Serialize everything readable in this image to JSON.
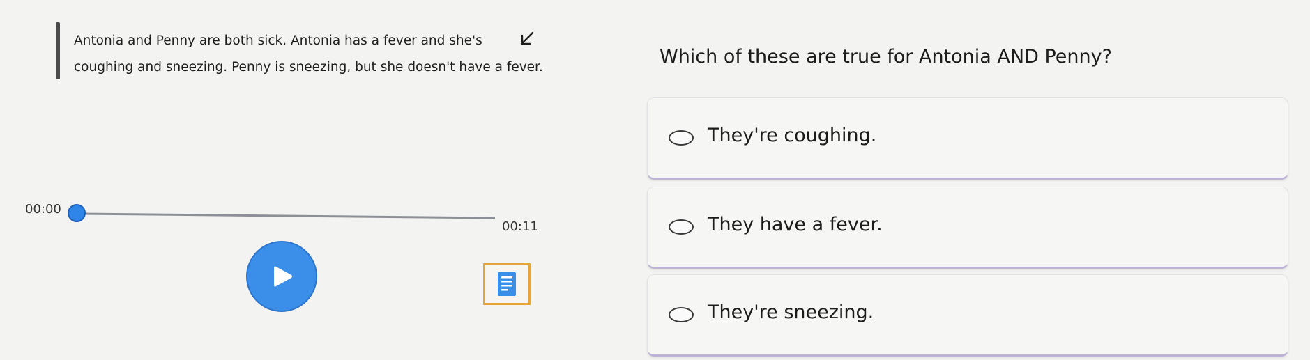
{
  "passage": {
    "line1": "Antonia and Penny are both sick. Antonia has a fever and she's",
    "line2": "coughing and sneezing. Penny is sneezing, but she doesn't have a fever."
  },
  "audio": {
    "current_time": "00:00",
    "duration": "00:11",
    "progress": 0
  },
  "question": {
    "prompt": "Which of these are true for Antonia AND Penny?",
    "options": [
      {
        "label": "They're coughing."
      },
      {
        "label": "They have a fever."
      },
      {
        "label": "They're sneezing."
      }
    ]
  },
  "icons": {
    "collapse": "arrow-down-left-icon",
    "play": "play-icon",
    "transcript": "transcript-icon"
  },
  "colors": {
    "accent_blue": "#3b8fe9",
    "transcript_border": "#e6a43a",
    "option_border": "#bcb3d6"
  }
}
